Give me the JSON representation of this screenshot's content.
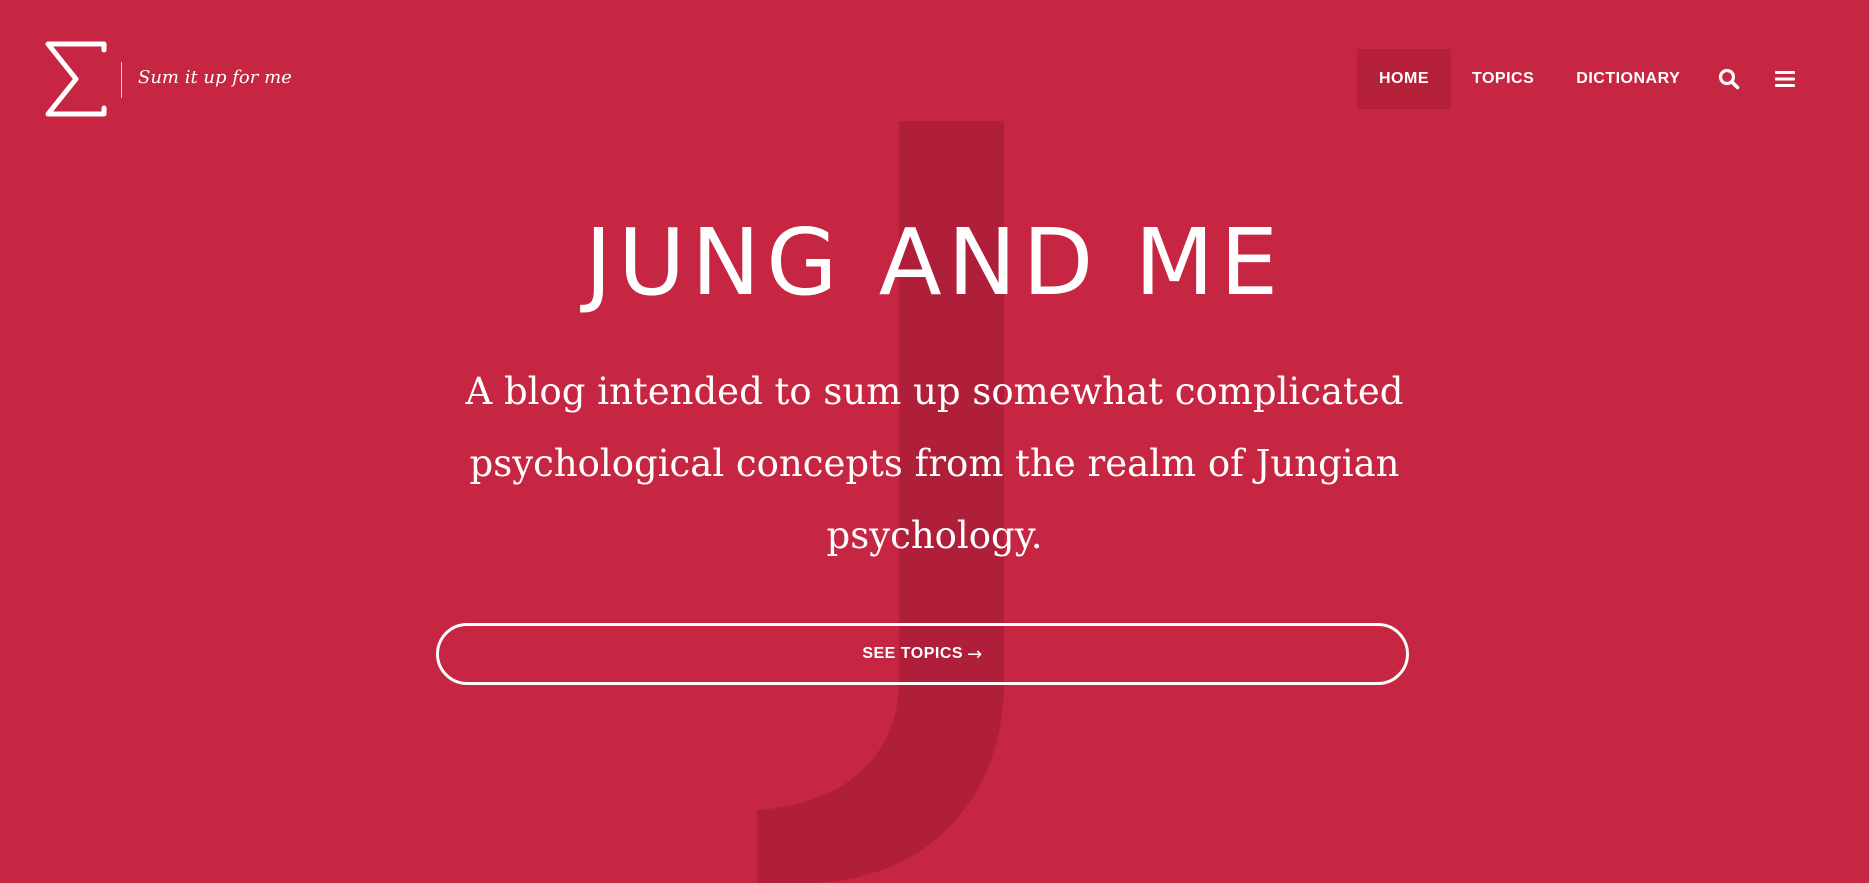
{
  "colors": {
    "background": "#c62641",
    "watermark": "#b01f3a",
    "nav_active_bg": "#b52039",
    "foreground": "#ffffff"
  },
  "header": {
    "logo_icon": "sigma-icon",
    "tagline": "Sum it up for me",
    "nav": {
      "items": [
        {
          "label": "HOME",
          "active": true
        },
        {
          "label": "TOPICS",
          "active": false
        },
        {
          "label": "DICTIONARY",
          "active": false
        }
      ],
      "search_icon": "search-icon",
      "menu_icon": "hamburger-menu-icon"
    }
  },
  "hero": {
    "watermark_letter_icon": "letter-j-watermark",
    "title": "JUNG AND ME",
    "subtitle": "A blog intended to sum up somewhat complicated psychological concepts from the realm of Jungian psychology.",
    "cta": {
      "label": "SEE TOPICS",
      "arrow": "→"
    }
  }
}
